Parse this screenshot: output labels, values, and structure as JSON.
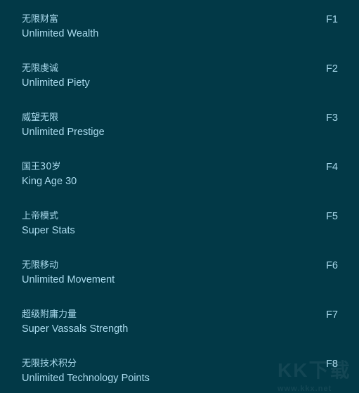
{
  "colors": {
    "background": "#023947",
    "text": "#a9d9ec"
  },
  "cheats": [
    {
      "cn": "无限财富",
      "en": "Unlimited Wealth",
      "key": "F1"
    },
    {
      "cn": "无限虔诚",
      "en": "Unlimited Piety",
      "key": "F2"
    },
    {
      "cn": "威望无限",
      "en": "Unlimited Prestige",
      "key": "F3"
    },
    {
      "cn": "国王30岁",
      "en": "King Age 30",
      "key": "F4"
    },
    {
      "cn": "上帝模式",
      "en": "Super Stats",
      "key": "F5"
    },
    {
      "cn": "无限移动",
      "en": "Unlimited Movement",
      "key": "F6"
    },
    {
      "cn": "超级附庸力量",
      "en": "Super Vassals Strength",
      "key": "F7"
    },
    {
      "cn": "无限技术积分",
      "en": "Unlimited Technology Points",
      "key": "F8"
    }
  ],
  "watermark": {
    "logo": "KK下载",
    "url": "www.kkx.net"
  }
}
